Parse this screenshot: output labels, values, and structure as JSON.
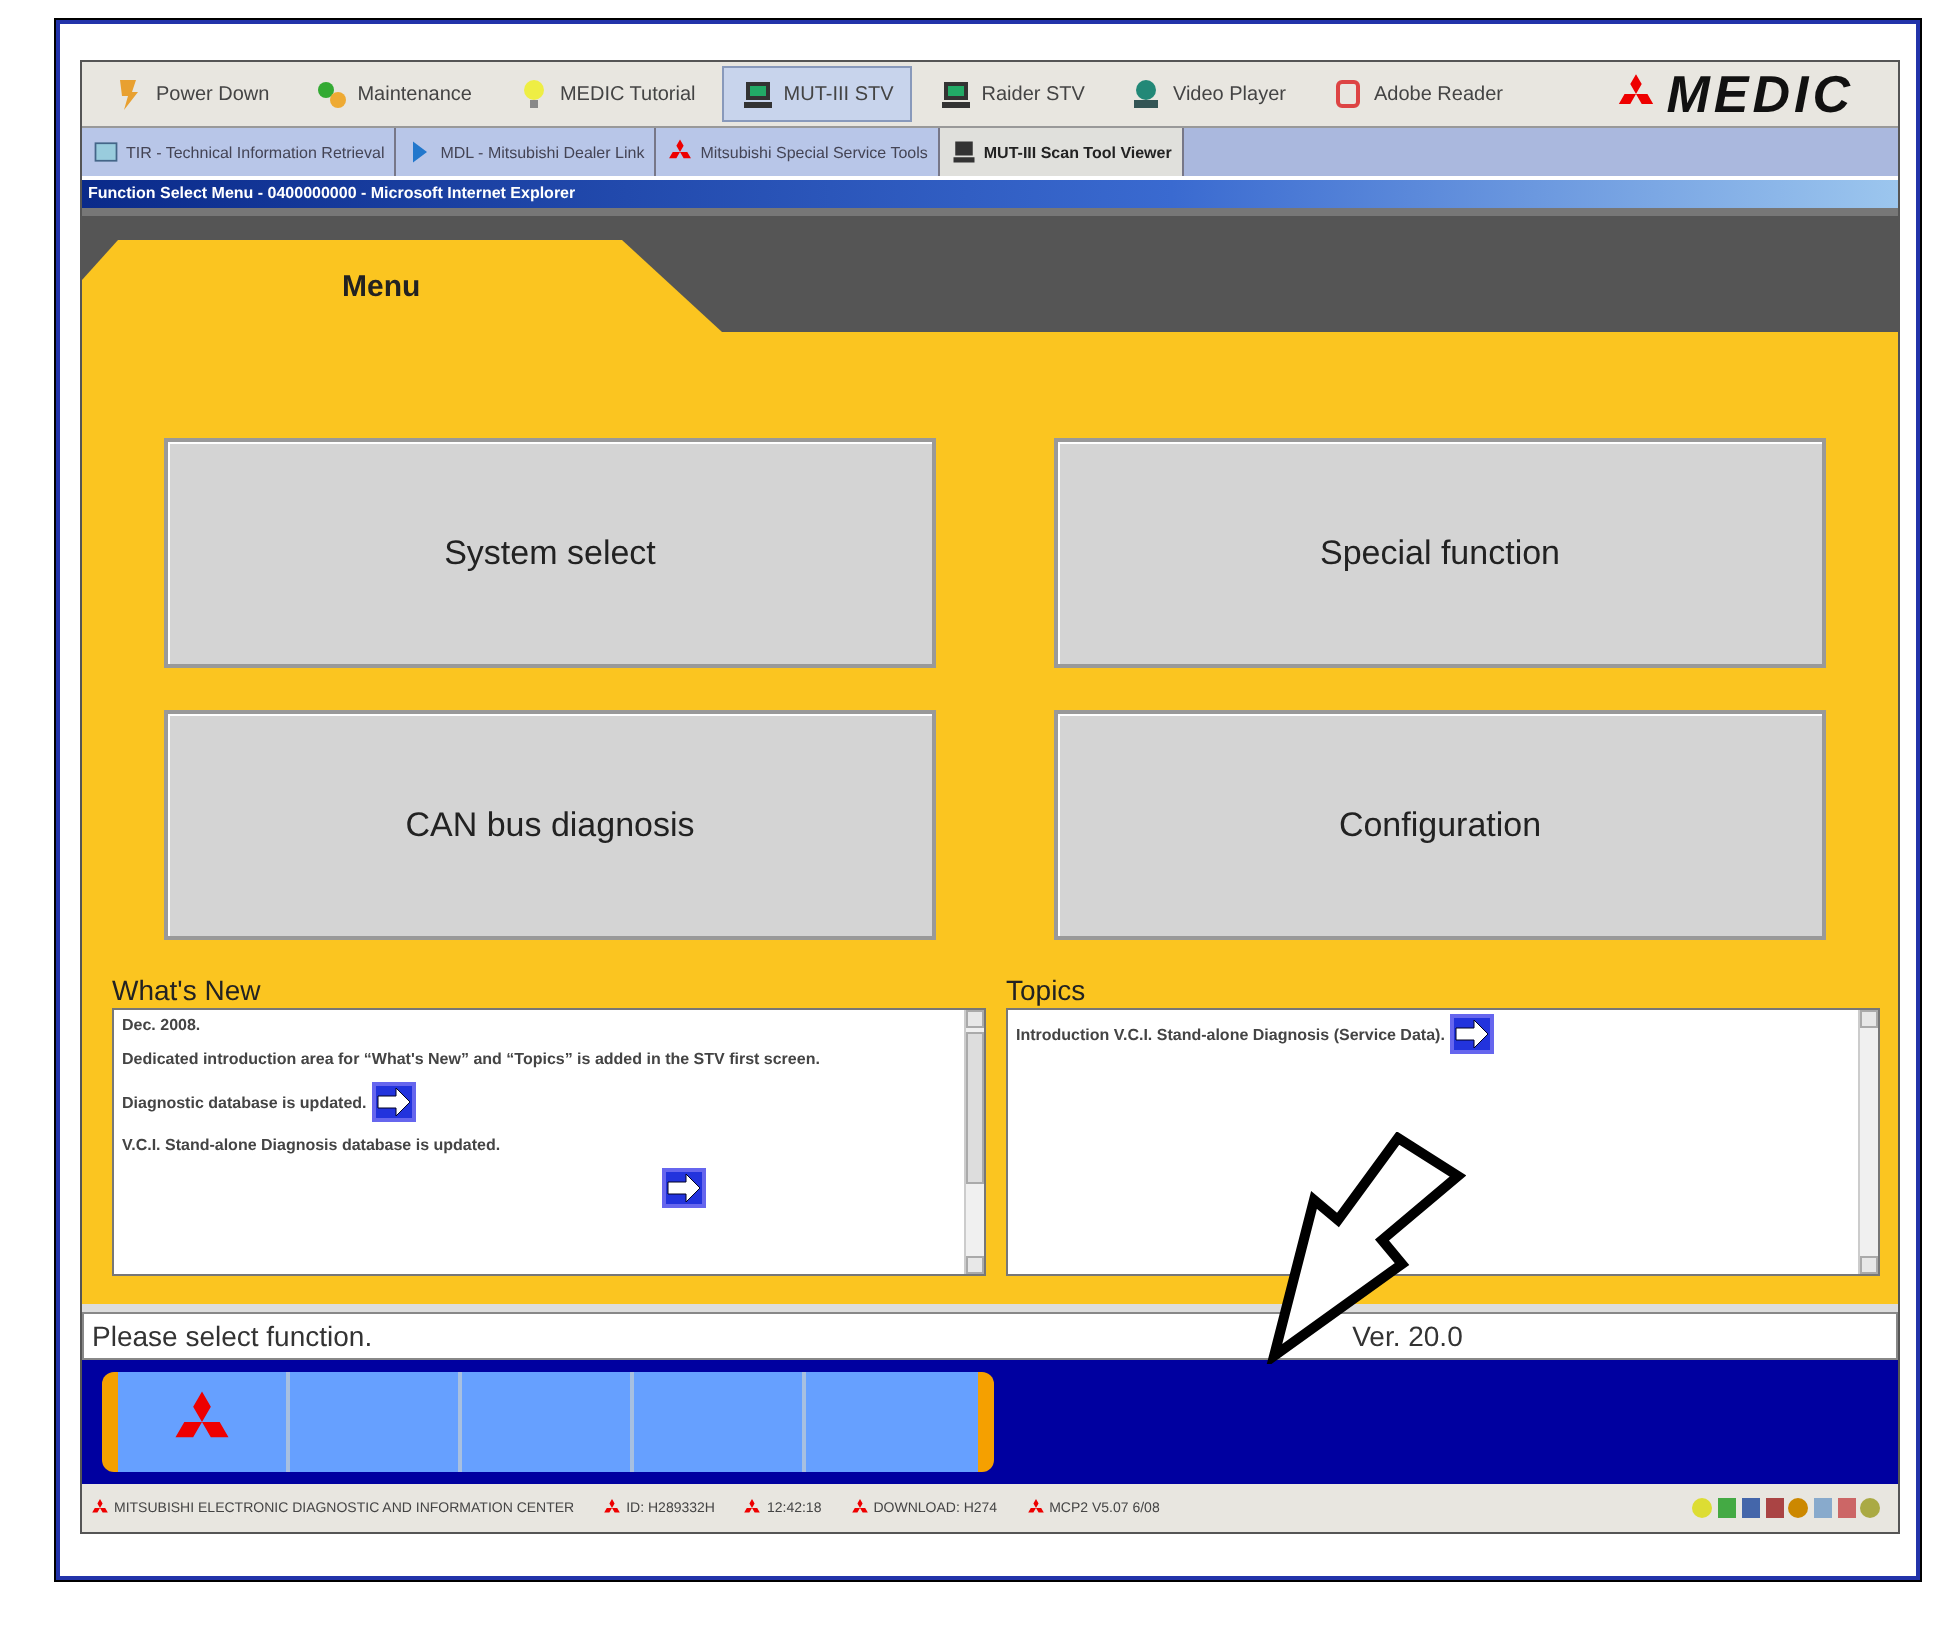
{
  "toolbar": {
    "items": [
      {
        "label": "Power Down",
        "selected": false
      },
      {
        "label": "Maintenance",
        "selected": false
      },
      {
        "label": "MEDIC Tutorial",
        "selected": false
      },
      {
        "label": "MUT-III STV",
        "selected": true
      },
      {
        "label": "Raider STV",
        "selected": false
      },
      {
        "label": "Video Player",
        "selected": false
      },
      {
        "label": "Adobe Reader",
        "selected": false
      }
    ],
    "logo": "MEDIC"
  },
  "tabs": [
    {
      "label": "TIR - Technical Information Retrieval",
      "selected": false
    },
    {
      "label": "MDL - Mitsubishi Dealer Link",
      "selected": false
    },
    {
      "label": "Mitsubishi Special Service Tools",
      "selected": false
    },
    {
      "label": "MUT-III Scan Tool Viewer",
      "selected": true
    }
  ],
  "window": {
    "title": "Function Select Menu - 0400000000 - Microsoft Internet Explorer"
  },
  "menu_tab": "Menu",
  "buttons": [
    "System select",
    "Special function",
    "CAN bus diagnosis",
    "Configuration"
  ],
  "whats_new": {
    "heading": "What's New",
    "items": [
      {
        "text": "Dec. 2008.",
        "kind": "text"
      },
      {
        "text": "Dedicated introduction area for “What's New” and “Topics” is added in the STV first screen.",
        "kind": "text"
      },
      {
        "text": "Diagnostic database is updated.",
        "kind": "linked"
      },
      {
        "text": "V.C.I. Stand-alone Diagnosis database is updated.",
        "kind": "linkbelow"
      }
    ]
  },
  "topics": {
    "heading": "Topics",
    "items": [
      {
        "text": "Introduction V.C.I. Stand-alone Diagnosis (Service Data).",
        "kind": "linked"
      }
    ]
  },
  "status_bar": {
    "message": "Please select function.",
    "version": "Ver. 20.0"
  },
  "taskbar": {
    "items": [
      "MITSUBISHI ELECTRONIC DIAGNOSTIC AND INFORMATION CENTER",
      "ID: H289332H",
      "12:42:18",
      "DOWNLOAD: H274",
      "MCP2 V5.07 6/08"
    ]
  }
}
